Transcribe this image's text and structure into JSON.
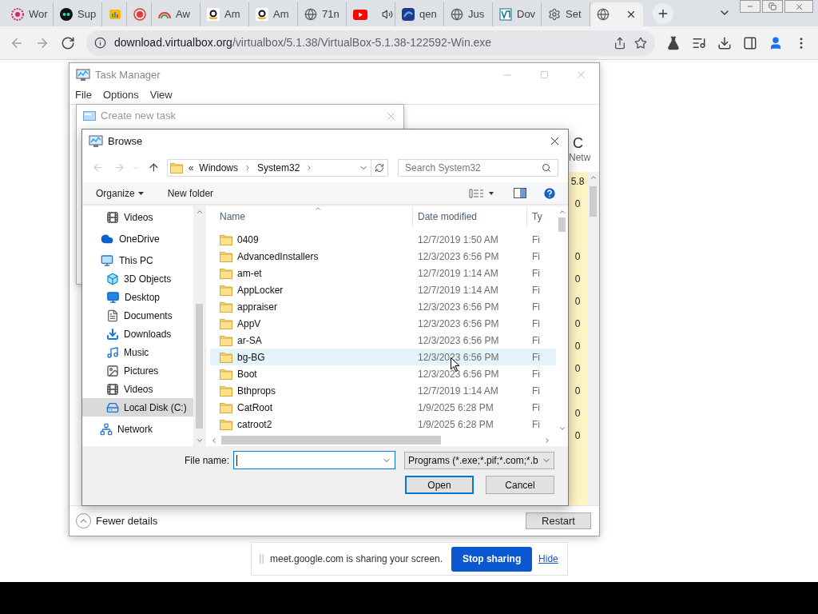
{
  "browser": {
    "tabs": [
      {
        "title": "Wor",
        "selected": false
      },
      {
        "title": "Sup",
        "selected": false
      },
      {
        "selected": false
      },
      {
        "selected": false
      },
      {
        "title": "Aw",
        "selected": false
      },
      {
        "title": "Am",
        "selected": false
      },
      {
        "title": "Am",
        "selected": false
      },
      {
        "title": "71n",
        "selected": false
      },
      {
        "selected": false
      },
      {
        "title": "qen",
        "selected": false
      },
      {
        "title": "Jus",
        "selected": false
      },
      {
        "title": "Dov",
        "selected": false
      },
      {
        "title": "Set",
        "selected": false
      },
      {
        "selected": true
      }
    ],
    "address_bar": {
      "domain": "download.virtualbox.org",
      "path": "/virtualbox/5.1.38/VirtualBox-5.1.38-122592-Win.exe"
    }
  },
  "task_manager": {
    "title": "Task Manager",
    "menu": [
      "File",
      "Options",
      "View"
    ],
    "column_heading": "C",
    "column_label": "Netw",
    "network_values": [
      "5.8",
      "0",
      "0",
      "0",
      "0",
      "0",
      "0",
      "0",
      "0",
      "0",
      "0"
    ],
    "fewer_details": "Fewer details",
    "restart": "Restart"
  },
  "create_new_task": {
    "title": "Create new task"
  },
  "browse": {
    "title": "Browse",
    "path_overflow": "«",
    "path": [
      "Windows",
      "System32"
    ],
    "search_placeholder": "Search System32",
    "organize": "Organize",
    "new_folder": "New folder",
    "nav_pane": [
      {
        "children": [
          {
            "label": "Videos",
            "selected": false
          }
        ]
      },
      {
        "label": "OneDrive",
        "selected": false
      },
      {
        "label": "This PC",
        "selected": false,
        "children": [
          {
            "label": "3D Objects",
            "selected": false
          },
          {
            "label": "Desktop",
            "selected": false
          },
          {
            "label": "Documents",
            "selected": false
          },
          {
            "label": "Downloads",
            "selected": false
          },
          {
            "label": "Music",
            "selected": false
          },
          {
            "label": "Pictures",
            "selected": false
          },
          {
            "label": "Videos",
            "selected": false
          },
          {
            "label": "Local Disk (C:)",
            "selected": true
          }
        ]
      },
      {
        "label": "Network",
        "selected": false
      }
    ],
    "columns": [
      "Name",
      "Date modified",
      "Ty"
    ],
    "rows": [
      {
        "name": "0409",
        "date": "12/7/2019 1:50 AM",
        "type": "Fi",
        "hovered": false
      },
      {
        "name": "AdvancedInstallers",
        "date": "12/3/2023 6:56 PM",
        "type": "Fi",
        "hovered": false
      },
      {
        "name": "am-et",
        "date": "12/7/2019 1:14 AM",
        "type": "Fi",
        "hovered": false
      },
      {
        "name": "AppLocker",
        "date": "12/7/2019 1:14 AM",
        "type": "Fi",
        "hovered": false
      },
      {
        "name": "appraiser",
        "date": "12/3/2023 6:56 PM",
        "type": "Fi",
        "hovered": false
      },
      {
        "name": "AppV",
        "date": "12/3/2023 6:56 PM",
        "type": "Fi",
        "hovered": false
      },
      {
        "name": "ar-SA",
        "date": "12/3/2023 6:56 PM",
        "type": "Fi",
        "hovered": false
      },
      {
        "name": "bg-BG",
        "date": "12/3/2023 6:56 PM",
        "type": "Fi",
        "hovered": true
      },
      {
        "name": "Boot",
        "date": "12/3/2023 6:56 PM",
        "type": "Fi",
        "hovered": false
      },
      {
        "name": "Bthprops",
        "date": "12/7/2019 1:14 AM",
        "type": "Fi",
        "hovered": false
      },
      {
        "name": "CatRoot",
        "date": "1/9/2025 6:28 PM",
        "type": "Fi",
        "hovered": false
      },
      {
        "name": "catroot2",
        "date": "1/9/2025 6:28 PM",
        "type": "Fi",
        "hovered": false
      }
    ],
    "file_name_label": "File name:",
    "file_type": "Programs (*.exe;*.pif;*.com;*.b",
    "buttons": [
      "Open",
      "Cancel"
    ]
  },
  "sharing_bar": {
    "message": "meet.google.com is sharing your screen.",
    "stop": "Stop sharing",
    "hide": "Hide"
  }
}
